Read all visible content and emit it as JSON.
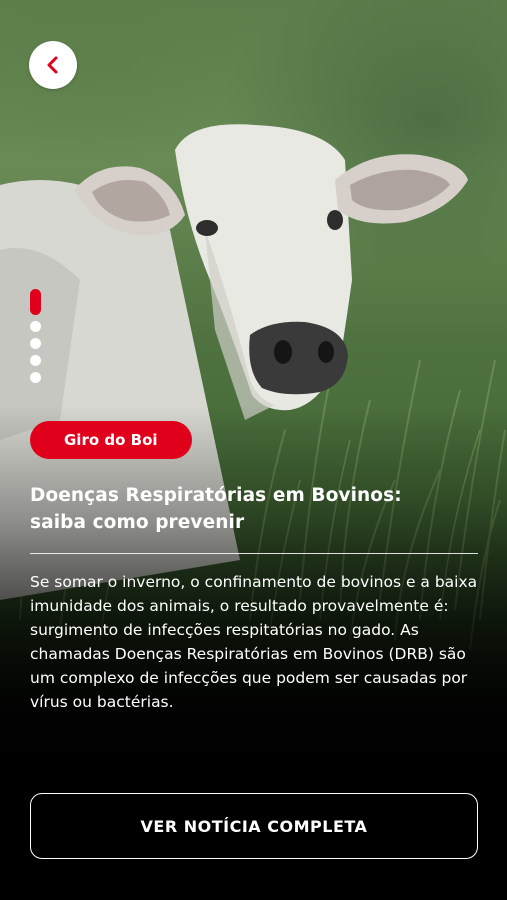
{
  "header": {
    "back_icon": "chevron-left-icon",
    "back_icon_color": "#e1001b"
  },
  "carousel": {
    "total": 5,
    "active_index": 0
  },
  "article": {
    "tag": "Giro do Boi",
    "title_line1": "Doenças Respiratórias em Bovinos:",
    "title_line2": "saiba como prevenir",
    "body": "Se somar o inverno, o confinamento de bovinos e a baixa imunidade dos animais, o resultado provavelmente é: surgimento de infecções respitatórias no gado. As chamadas Doenças Respiratórias em Bovinos (DRB) são um complexo de infecções que podem ser causadas por vírus ou bactérias."
  },
  "cta": {
    "label": "VER NOTÍCIA COMPLETA"
  },
  "colors": {
    "accent": "#e1001b",
    "text": "#ffffff",
    "background": "#000000"
  }
}
